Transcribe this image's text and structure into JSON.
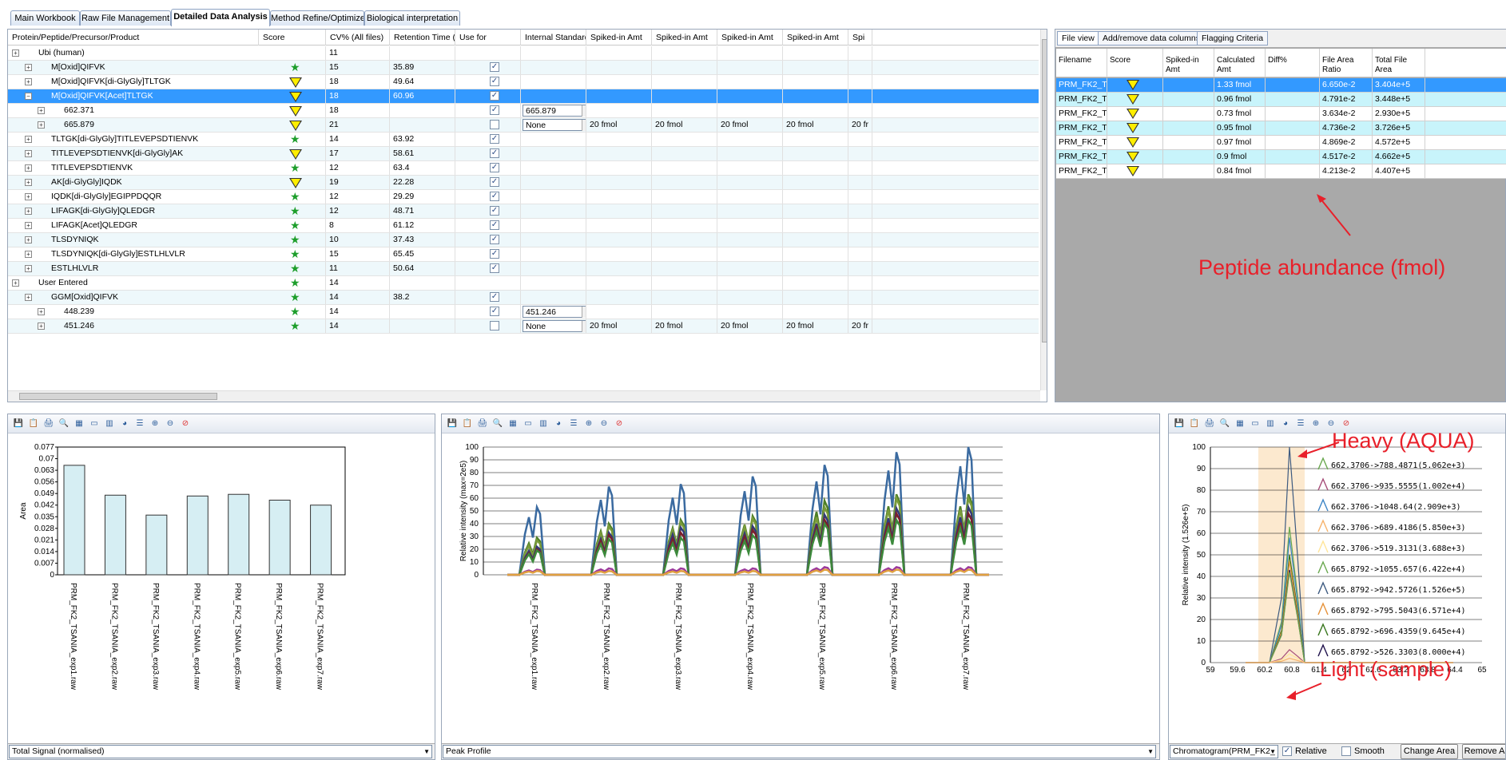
{
  "tabs": [
    "Main Workbook",
    "Raw File Management",
    "Detailed Data Analysis",
    "Method Refine/Optimize",
    "Biological interpretation"
  ],
  "grid": {
    "columns": [
      "Protein/Peptide/Precursor/Product",
      "Score",
      "CV% (All files)",
      "Retention Time (in",
      "Use for",
      "Internal Standard",
      "Spiked-in Amt",
      "Spiked-in Amt",
      "Spiked-in Amt",
      "Spiked-in Amt",
      "Spi"
    ],
    "rows": [
      {
        "label": "Ubi (human)",
        "level": 0,
        "score": "",
        "cv": "11",
        "rt": "",
        "use": null,
        "is": "",
        "spk": false
      },
      {
        "label": "M[Oxid]QIFVK",
        "level": 1,
        "score": "star",
        "cv": "15",
        "rt": "35.89",
        "use": true,
        "is": "",
        "spk": false
      },
      {
        "label": "M[Oxid]QIFVK[di-GlyGly]TLTGK",
        "level": 1,
        "score": "tri",
        "cv": "18",
        "rt": "49.64",
        "use": true,
        "is": "",
        "spk": false
      },
      {
        "label": "M[Oxid]QIFVK[Acet]TLTGK",
        "level": 1,
        "score": "tri",
        "cv": "18",
        "rt": "60.96",
        "use": true,
        "is": "",
        "spk": false,
        "sel": true
      },
      {
        "label": "662.371",
        "level": 2,
        "score": "tri",
        "cv": "18",
        "rt": "",
        "use": true,
        "is": "665.879",
        "spk": false
      },
      {
        "label": "665.879",
        "level": 2,
        "score": "tri",
        "cv": "21",
        "rt": "",
        "use": false,
        "is": "None",
        "spk": true
      },
      {
        "label": "TLTGK[di-GlyGly]TITLEVEPSDTIENVK",
        "level": 1,
        "score": "star",
        "cv": "14",
        "rt": "63.92",
        "use": true,
        "is": "",
        "spk": false
      },
      {
        "label": "TITLEVEPSDTIENVK[di-GlyGly]AK",
        "level": 1,
        "score": "tri",
        "cv": "17",
        "rt": "58.61",
        "use": true,
        "is": "",
        "spk": false
      },
      {
        "label": "TITLEVEPSDTIENVK",
        "level": 1,
        "score": "star",
        "cv": "12",
        "rt": "63.4",
        "use": true,
        "is": "",
        "spk": false
      },
      {
        "label": "AK[di-GlyGly]IQDK",
        "level": 1,
        "score": "tri",
        "cv": "19",
        "rt": "22.28",
        "use": true,
        "is": "",
        "spk": false
      },
      {
        "label": "IQDK[di-GlyGly]EGIPPDQQR",
        "level": 1,
        "score": "star",
        "cv": "12",
        "rt": "29.29",
        "use": true,
        "is": "",
        "spk": false
      },
      {
        "label": "LIFAGK[di-GlyGly]QLEDGR",
        "level": 1,
        "score": "star",
        "cv": "12",
        "rt": "48.71",
        "use": true,
        "is": "",
        "spk": false
      },
      {
        "label": "LIFAGK[Acet]QLEDGR",
        "level": 1,
        "score": "star",
        "cv": "8",
        "rt": "61.12",
        "use": true,
        "is": "",
        "spk": false
      },
      {
        "label": "TLSDYNIQK",
        "level": 1,
        "score": "star",
        "cv": "10",
        "rt": "37.43",
        "use": true,
        "is": "",
        "spk": false
      },
      {
        "label": "TLSDYNIQK[di-GlyGly]ESTLHLVLR",
        "level": 1,
        "score": "star",
        "cv": "15",
        "rt": "65.45",
        "use": true,
        "is": "",
        "spk": false
      },
      {
        "label": "ESTLHLVLR",
        "level": 1,
        "score": "star",
        "cv": "11",
        "rt": "50.64",
        "use": true,
        "is": "",
        "spk": false
      },
      {
        "label": "User Entered",
        "level": 0,
        "score": "star",
        "cv": "14",
        "rt": "",
        "use": null,
        "is": "",
        "spk": false
      },
      {
        "label": "GGM[Oxid]QIFVK",
        "level": 1,
        "score": "star",
        "cv": "14",
        "rt": "38.2",
        "use": true,
        "is": "",
        "spk": false
      },
      {
        "label": "448.239",
        "level": 2,
        "score": "star",
        "cv": "14",
        "rt": "",
        "use": true,
        "is": "451.246",
        "spk": false
      },
      {
        "label": "451.246",
        "level": 2,
        "score": "star",
        "cv": "14",
        "rt": "",
        "use": false,
        "is": "None",
        "spk": true
      }
    ],
    "spiked_value": "20 fmol",
    "spiked_trunc": "20 fr"
  },
  "right": {
    "tabs": [
      "File view",
      "Add/remove data columns",
      "Flagging Criteria"
    ],
    "columns": [
      "Filename",
      "Score",
      "Spiked-in Amt",
      "Calculated Amt",
      "Diff%",
      "File Area Ratio",
      "Total File Area"
    ],
    "rows": [
      {
        "file": "PRM_FK2_T...",
        "amt": "1.33 fmol",
        "ratio": "6.650e-2",
        "area": "3.404e+5",
        "sel": true
      },
      {
        "file": "PRM_FK2_T...",
        "amt": "0.96 fmol",
        "ratio": "4.791e-2",
        "area": "3.448e+5"
      },
      {
        "file": "PRM_FK2_T...",
        "amt": "0.73 fmol",
        "ratio": "3.634e-2",
        "area": "2.930e+5"
      },
      {
        "file": "PRM_FK2_T...",
        "amt": "0.95 fmol",
        "ratio": "4.736e-2",
        "area": "3.726e+5"
      },
      {
        "file": "PRM_FK2_T...",
        "amt": "0.97 fmol",
        "ratio": "4.869e-2",
        "area": "4.572e+5"
      },
      {
        "file": "PRM_FK2_T...",
        "amt": "0.9 fmol",
        "ratio": "4.517e-2",
        "area": "4.662e+5"
      },
      {
        "file": "PRM_FK2_T...",
        "amt": "0.84 fmol",
        "ratio": "4.213e-2",
        "area": "4.407e+5"
      }
    ],
    "annotation": "Peptide abundance (fmol)"
  },
  "panel1": {
    "footer": "Total Signal (normalised)",
    "chart": {
      "type": "bar",
      "ylabel": "Area",
      "yticks": [
        "0.077",
        "0.07",
        "0.063",
        "0.056",
        "0.049",
        "0.042",
        "0.035",
        "0.028",
        "0.021",
        "0.014",
        "0.007",
        "0"
      ],
      "ymax": 0.077,
      "categories": [
        "PRM_FK2_TSANIA_exp1.raw",
        "PRM_FK2_TSANIA_exp2.raw",
        "PRM_FK2_TSANIA_exp3.raw",
        "PRM_FK2_TSANIA_exp4.raw",
        "PRM_FK2_TSANIA_exp5.raw",
        "PRM_FK2_TSANIA_exp6.raw",
        "PRM_FK2_TSANIA_exp7.raw"
      ],
      "values": [
        0.066,
        0.048,
        0.036,
        0.0475,
        0.0485,
        0.045,
        0.042
      ]
    }
  },
  "panel2": {
    "footer": "Peak Profile",
    "chart": {
      "type": "line",
      "ylabel": "Relative intensity (max=2e5)",
      "yticks": [
        "100",
        "90",
        "80",
        "70",
        "60",
        "50",
        "40",
        "30",
        "20",
        "10",
        "0"
      ],
      "categories": [
        "PRM_FK2_TSANIA_exp1.raw",
        "PRM_FK2_TSANIA_exp2.raw",
        "PRM_FK2_TSANIA_exp3.raw",
        "PRM_FK2_TSANIA_exp4.raw",
        "PRM_FK2_TSANIA_exp5.raw",
        "PRM_FK2_TSANIA_exp6.raw",
        "PRM_FK2_TSANIA_exp7.raw"
      ],
      "series": [
        {
          "color": "#3a6aa0",
          "peaks": [
            53,
            69,
            71,
            77,
            86,
            96,
            100
          ]
        },
        {
          "color": "#4e7f26",
          "peaks": [
            29,
            40,
            43,
            46,
            58,
            63,
            63
          ]
        },
        {
          "color": "#7a9b3a",
          "peaks": [
            27,
            38,
            41,
            44,
            53,
            60,
            60
          ]
        },
        {
          "color": "#333b77",
          "peaks": [
            22,
            33,
            37,
            38,
            47,
            52,
            53
          ]
        },
        {
          "color": "#7a1f2b",
          "peaks": [
            20,
            31,
            33,
            35,
            43,
            48,
            48
          ]
        },
        {
          "color": "#3c8a3c",
          "peaks": [
            19,
            28,
            29,
            31,
            40,
            43,
            43
          ]
        },
        {
          "color": "#9c3a9c",
          "peaks": [
            4,
            5,
            5,
            5,
            6,
            6,
            6
          ]
        },
        {
          "color": "#e0a040",
          "peaks": [
            3,
            3,
            3,
            3,
            4,
            4,
            4
          ]
        }
      ]
    }
  },
  "panel3": {
    "footer_combo": "Chromatogram(PRM_FK2_",
    "relative": "Relative",
    "smooth": "Smooth",
    "change_area": "Change Area",
    "remove_area": "Remove Area",
    "chart": {
      "type": "line",
      "ylabel": "Relative intensity (1.526e+5)",
      "yticks": [
        "100",
        "90",
        "80",
        "70",
        "60",
        "50",
        "40",
        "30",
        "20",
        "10",
        "0"
      ],
      "xticks": [
        "59",
        "59.6",
        "60.2",
        "60.8",
        "61.4",
        "62",
        "62.6",
        "63.2",
        "63.8",
        "64.4",
        "65"
      ],
      "legend": [
        {
          "label": "662.3706->788.4871(5.062e+3)",
          "color": "#6aa84f"
        },
        {
          "label": "662.3706->935.5555(1.002e+4)",
          "color": "#a64d79"
        },
        {
          "label": "662.3706->1048.64(2.909e+3)",
          "color": "#3d85c6"
        },
        {
          "label": "662.3706->689.4186(5.850e+3)",
          "color": "#f6b26b"
        },
        {
          "label": "662.3706->519.3131(3.688e+3)",
          "color": "#ffe599"
        },
        {
          "label": "665.8792->1055.657(6.422e+4)",
          "color": "#6aa84f"
        },
        {
          "label": "665.8792->942.5726(1.526e+5)",
          "color": "#3d5a80"
        },
        {
          "label": "665.8792->795.5043(6.571e+4)",
          "color": "#e69138"
        },
        {
          "label": "665.8792->696.4359(9.645e+4)",
          "color": "#38761d"
        },
        {
          "label": "665.8792->526.3303(8.000e+4)",
          "color": "#20124d"
        }
      ]
    },
    "heavy_label": "Heavy (AQUA)",
    "light_label": "Light (sample)"
  }
}
